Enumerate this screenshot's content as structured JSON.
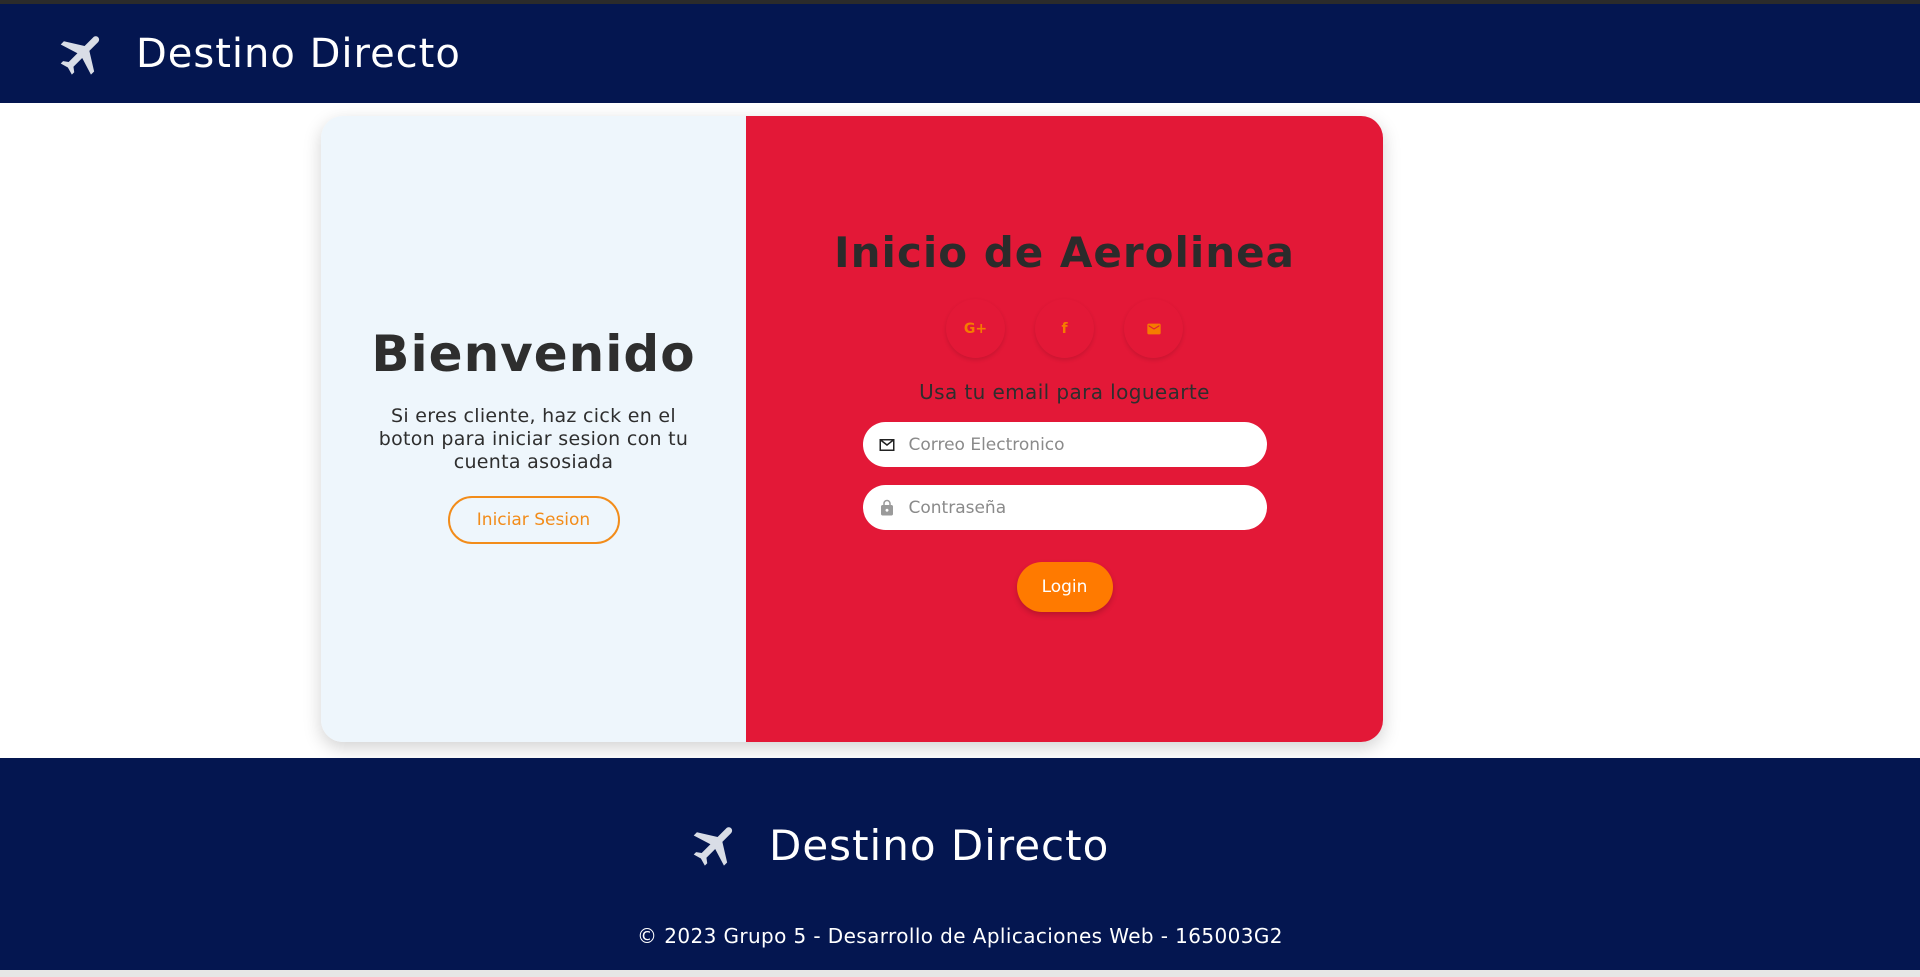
{
  "header": {
    "brand_name": "Destino Directo",
    "logo_icon": "airplane-icon"
  },
  "welcome_panel": {
    "title": "Bienvenido",
    "text": "Si eres cliente, haz cick en el boton para iniciar sesion con tu cuenta asosiada",
    "button_label": "Iniciar Sesion"
  },
  "login_panel": {
    "title": "Inicio de Aerolinea",
    "social_icons": [
      "google-plus-icon",
      "facebook-icon",
      "email-icon"
    ],
    "google_glyph": "G+",
    "facebook_glyph": "f",
    "hint": "Usa tu email para loguearte",
    "email_placeholder": "Correo Electronico",
    "password_placeholder": "Contraseña",
    "login_label": "Login"
  },
  "footer": {
    "brand_name": "Destino Directo",
    "copyright": "© 2023 Grupo 5 - Desarrollo de Aplicaciones Web - 165003G2"
  },
  "colors": {
    "navy": "#041650",
    "red": "#e31837",
    "orange": "#ff7a00",
    "light_panel": "#eef6fc"
  }
}
